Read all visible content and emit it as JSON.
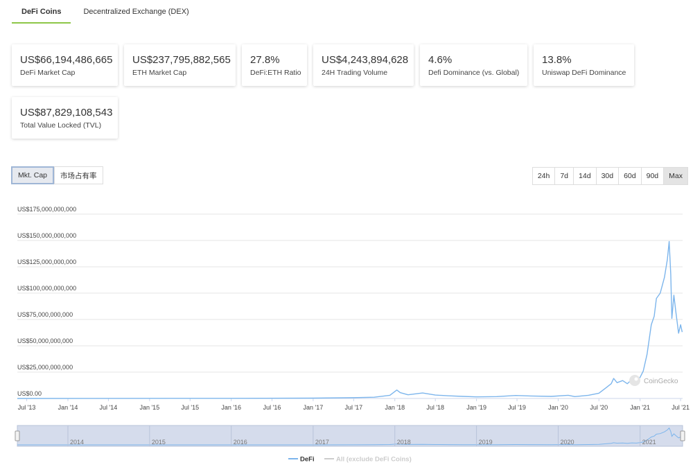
{
  "tabs": [
    {
      "label": "DeFi Coins",
      "active": true
    },
    {
      "label": "Decentralized Exchange (DEX)",
      "active": false
    }
  ],
  "stats": [
    {
      "value": "US$66,194,486,665",
      "label": "DeFi Market Cap"
    },
    {
      "value": "US$237,795,882,565",
      "label": "ETH Market Cap"
    },
    {
      "value": "27.8%",
      "label": "DeFi:ETH Ratio"
    },
    {
      "value": "US$4,243,894,628",
      "label": "24H Trading Volume"
    },
    {
      "value": "4.6%",
      "label": "Defi Dominance (vs. Global)"
    },
    {
      "value": "13.8%",
      "label": "Uniswap DeFi Dominance"
    },
    {
      "value": "US$87,829,108,543",
      "label": "Total Value Locked (TVL)"
    }
  ],
  "chart_toggle": {
    "mkt_cap": "Mkt. Cap",
    "dominance": "市场占有率"
  },
  "ranges": [
    "24h",
    "7d",
    "14d",
    "30d",
    "60d",
    "90d",
    "Max"
  ],
  "active_range": "Max",
  "watermark": "CoinGecko",
  "colors": {
    "defi_line": "#7cb5ec",
    "all_line": "#cccccc",
    "tab_accent": "#8dc647"
  },
  "chart_data": {
    "type": "line",
    "title": "",
    "xlabel": "",
    "ylabel": "",
    "ylim": [
      0,
      175000000000
    ],
    "y_ticks": [
      0,
      25000000000,
      50000000000,
      75000000000,
      100000000000,
      125000000000,
      150000000000,
      175000000000
    ],
    "y_tick_labels": [
      "US$0.00",
      "US$25,000,000,000",
      "US$50,000,000,000",
      "US$75,000,000,000",
      "US$100,000,000,000",
      "US$125,000,000,000",
      "US$150,000,000,000",
      "US$175,000,000,000"
    ],
    "x_range": [
      "2013-05-20",
      "2021-07-10"
    ],
    "x_tick_labels": [
      {
        "label": "Jul '13",
        "date": "2013-07-01"
      },
      {
        "label": "Jan '14",
        "date": "2014-01-01"
      },
      {
        "label": "Jul '14",
        "date": "2014-07-01"
      },
      {
        "label": "Jan '15",
        "date": "2015-01-01"
      },
      {
        "label": "Jul '15",
        "date": "2015-07-01"
      },
      {
        "label": "Jan '16",
        "date": "2016-01-01"
      },
      {
        "label": "Jul '16",
        "date": "2016-07-01"
      },
      {
        "label": "Jan '17",
        "date": "2017-01-01"
      },
      {
        "label": "Jul '17",
        "date": "2017-07-01"
      },
      {
        "label": "Jan '18",
        "date": "2018-01-01"
      },
      {
        "label": "Jul '18",
        "date": "2018-07-01"
      },
      {
        "label": "Jan '19",
        "date": "2019-01-01"
      },
      {
        "label": "Jul '19",
        "date": "2019-07-01"
      },
      {
        "label": "Jan '20",
        "date": "2020-01-01"
      },
      {
        "label": "Jul '20",
        "date": "2020-07-01"
      },
      {
        "label": "Jan '21",
        "date": "2021-01-01"
      },
      {
        "label": "Jul '21",
        "date": "2021-07-01"
      }
    ],
    "grid": true,
    "legend_position": "bottom-center",
    "series": [
      {
        "name": "DeFi",
        "color": "#7cb5ec",
        "points": [
          [
            "2013-05-20",
            0
          ],
          [
            "2016-01-01",
            0.1
          ],
          [
            "2017-01-01",
            0.3
          ],
          [
            "2017-07-01",
            0.8
          ],
          [
            "2017-10-01",
            1.2
          ],
          [
            "2017-12-10",
            3
          ],
          [
            "2018-01-10",
            8
          ],
          [
            "2018-01-25",
            5.5
          ],
          [
            "2018-03-01",
            3.5
          ],
          [
            "2018-05-05",
            5.2
          ],
          [
            "2018-07-01",
            3.2
          ],
          [
            "2018-09-01",
            2.5
          ],
          [
            "2018-11-01",
            2
          ],
          [
            "2019-01-01",
            1.5
          ],
          [
            "2019-04-01",
            1.8
          ],
          [
            "2019-06-25",
            2.8
          ],
          [
            "2019-09-01",
            2.4
          ],
          [
            "2019-12-01",
            2
          ],
          [
            "2020-02-15",
            3
          ],
          [
            "2020-03-15",
            1.8
          ],
          [
            "2020-05-15",
            3
          ],
          [
            "2020-07-01",
            5
          ],
          [
            "2020-08-01",
            10
          ],
          [
            "2020-08-25",
            14
          ],
          [
            "2020-09-05",
            19
          ],
          [
            "2020-09-20",
            15
          ],
          [
            "2020-10-15",
            17
          ],
          [
            "2020-11-05",
            14
          ],
          [
            "2020-11-25",
            18
          ],
          [
            "2020-12-15",
            16
          ],
          [
            "2021-01-01",
            20
          ],
          [
            "2021-01-15",
            26
          ],
          [
            "2021-02-01",
            42
          ],
          [
            "2021-02-20",
            70
          ],
          [
            "2021-03-05",
            78
          ],
          [
            "2021-03-15",
            95
          ],
          [
            "2021-04-01",
            100
          ],
          [
            "2021-04-20",
            115
          ],
          [
            "2021-05-03",
            132
          ],
          [
            "2021-05-11",
            149
          ],
          [
            "2021-05-18",
            118
          ],
          [
            "2021-05-23",
            76
          ],
          [
            "2021-06-01",
            98
          ],
          [
            "2021-06-10",
            82
          ],
          [
            "2021-06-22",
            62
          ],
          [
            "2021-07-01",
            70
          ],
          [
            "2021-07-08",
            63
          ]
        ]
      },
      {
        "name": "All (exclude DeFi Coins)",
        "color": "#cccccc",
        "points": []
      }
    ]
  },
  "navigator": {
    "year_labels": [
      "2014",
      "2015",
      "2016",
      "2017",
      "2018",
      "2019",
      "2020",
      "2021"
    ]
  }
}
